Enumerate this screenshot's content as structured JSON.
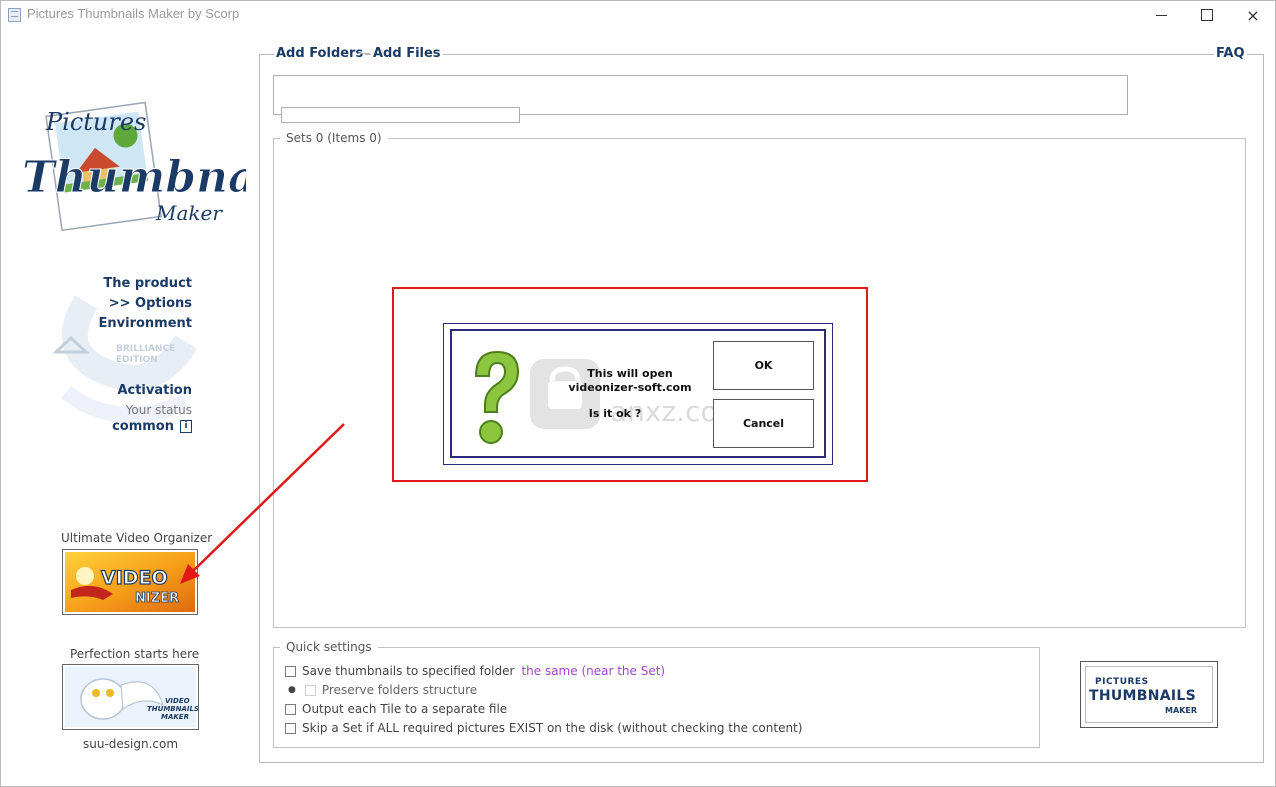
{
  "window": {
    "title": "Pictures Thumbnails Maker by Scorp",
    "controls": {
      "minimize": "minimize-icon",
      "maximize": "maximize-icon",
      "close": "×"
    }
  },
  "logo": {
    "line1": "Pictures",
    "line2": "Thumbnails",
    "line3": "Maker"
  },
  "sidebar": {
    "product": "The product",
    "options": ">> Options",
    "environment": "Environment",
    "edition_line1": "BRILLIANCE",
    "edition_line2": "EDITION",
    "activation": "Activation",
    "status": "Your status",
    "status_value": "common",
    "info_glyph": "i",
    "promo1_caption": "Ultimate Video Organizer",
    "promo1_word1": "VIDEO",
    "promo1_word2": "NIZER",
    "promo2_caption": "Perfection starts here",
    "promo2_line1": "VIDEO",
    "promo2_line2": "THUMBNAILS",
    "promo2_line3": "MAKER",
    "website": "suu-design.com"
  },
  "toolbar": {
    "add_folders": "Add Folders",
    "add_files": "Add Files",
    "faq": "FAQ"
  },
  "sets": {
    "label": "Sets 0 (Items 0)"
  },
  "quick_settings": {
    "title": "Quick settings",
    "save_label": "Save thumbnails to specified folder",
    "save_link": "the same (near the Set)",
    "preserve_label": "Preserve folders structure",
    "output_label": "Output each Tile to a separate file",
    "skip_label": "Skip a Set if ALL required pictures EXIST on the disk (without checking the content)"
  },
  "dialog": {
    "line1": "This will open",
    "line2": "videonizer-soft.com",
    "line3": "Is it ok ?",
    "ok": "OK",
    "cancel": "Cancel"
  },
  "watermark": {
    "text": "anxz.com"
  },
  "brand_badge": {
    "line1": "PICTURES",
    "line2": "THUMBNAILS",
    "line3": "MAKER"
  },
  "colors": {
    "navy": "#1b3a66",
    "highlight": "#e01818",
    "dialog_border": "#2b2b7e",
    "link": "#a345c8",
    "qmark": "#8cc63f"
  }
}
